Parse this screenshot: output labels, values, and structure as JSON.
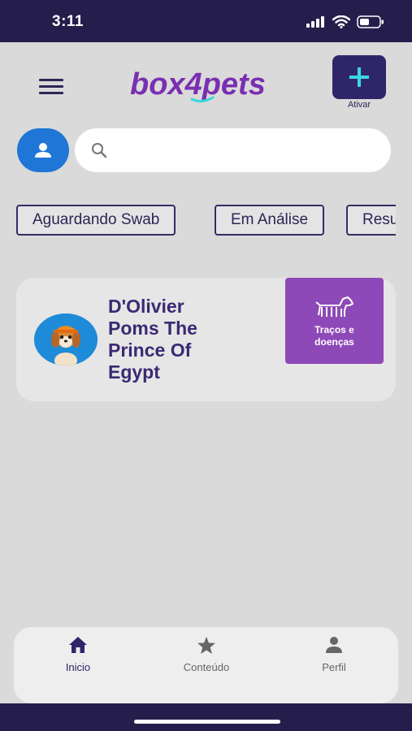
{
  "status_bar": {
    "time": "3:11"
  },
  "header": {
    "logo_text_a": "box",
    "logo_text_b": "4",
    "logo_text_c": "pets",
    "activate_label": "Ativar"
  },
  "search": {
    "placeholder": "",
    "value": ""
  },
  "filters": [
    "Aguardando Swab",
    "Em Análise",
    "Resu"
  ],
  "pet": {
    "name": "D'Olivier Poms The Prince  Of Egypt",
    "traits_label_1": "Traços e",
    "traits_label_2": "doenças"
  },
  "nav": {
    "items": [
      {
        "label": "Inicio",
        "icon": "home-icon",
        "active": true
      },
      {
        "label": "Conteúdo",
        "icon": "star-icon",
        "active": false
      },
      {
        "label": "Perfil",
        "icon": "person-icon",
        "active": false
      }
    ]
  },
  "colors": {
    "brand_purple": "#7a2fb0",
    "header_dark": "#251e4c",
    "accent_teal": "#3bd6e0",
    "chip_border": "#342c66",
    "traits_purple": "#8e49b8",
    "avatar_blue": "#1f76d6"
  }
}
